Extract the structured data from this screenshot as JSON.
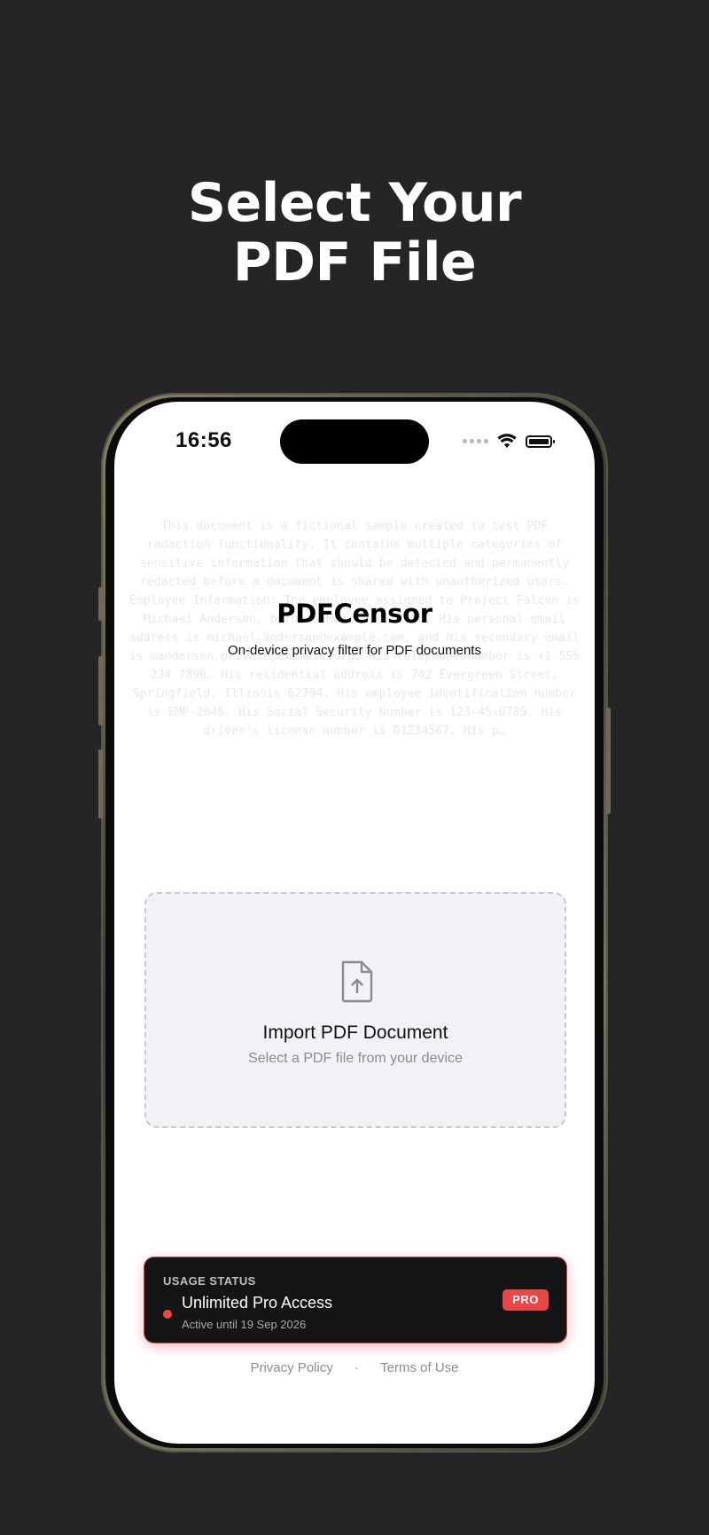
{
  "headline": {
    "line1": "Select Your",
    "line2": "PDF File"
  },
  "status_bar": {
    "time": "16:56",
    "icons": [
      "signal-dots-icon",
      "wifi-icon",
      "battery-icon"
    ]
  },
  "background_text": "This document is a fictional sample created to test PDF redaction functionality. It contains multiple categories of sensitive information that should be detected and permanently redacted before a document is shared with unauthorized users. Employee Information: The employee assigned to Project Falcon is Michael Anderson, born on March 14, 1986. His personal email address is michael.anderson@example.com, and his secondary email is manderson.private@example.org. His telephone number is +1 555 234 7890. His residential address is 742 Evergreen Street, Springfield, Illinois 62704. His employee identification number is EMP-2048. His Social Security Number is 123-45-6789. His driver's license number is D1234567. His p…",
  "app": {
    "title": "PDFCensor",
    "subtitle": "On-device privacy filter for PDF documents"
  },
  "import": {
    "icon": "file-upload-icon",
    "title": "Import PDF Document",
    "subtitle": "Select a PDF file from your device"
  },
  "usage": {
    "label": "USAGE STATUS",
    "title": "Unlimited Pro Access",
    "subtitle": "Active until 19 Sep 2026",
    "badge": "PRO"
  },
  "footer": {
    "privacy": "Privacy Policy",
    "separator": "·",
    "terms": "Terms of Use"
  },
  "colors": {
    "page_background": "#252527",
    "accent_red": "#e84848",
    "card_dark": "#151515",
    "import_bg": "#f1f1f6"
  }
}
